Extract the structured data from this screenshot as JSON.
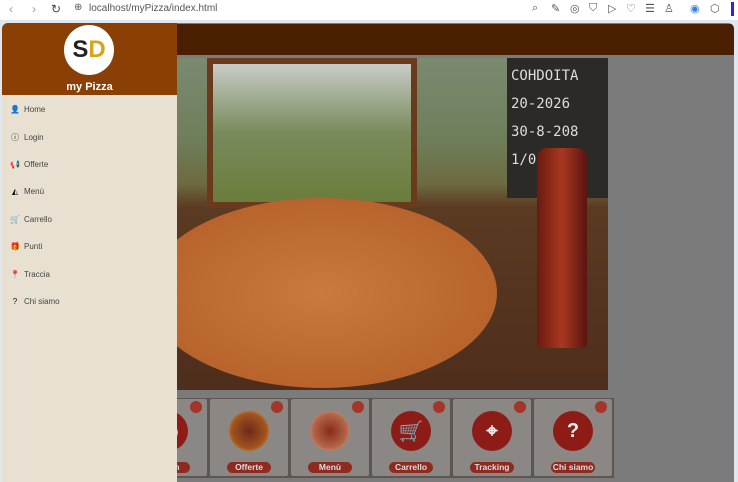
{
  "browser": {
    "url": "localhost/myPizza/index.html",
    "back_icon": "chevron-left",
    "forward_icon": "chevron-right",
    "reload_icon": "reload",
    "site_icon": "globe"
  },
  "sidebar": {
    "brand": "my Pizza",
    "logo_text": "SD",
    "items": [
      {
        "label": "Home",
        "icon": "user-icon",
        "glyph": "👤"
      },
      {
        "label": "Login",
        "icon": "info-circle-icon",
        "glyph": "ⓘ"
      },
      {
        "label": "Offerte",
        "icon": "megaphone-icon",
        "glyph": "📢"
      },
      {
        "label": "Menù",
        "icon": "pizza-slice-icon",
        "glyph": "◭"
      },
      {
        "label": "Carrello",
        "icon": "cart-icon",
        "glyph": "🛒"
      },
      {
        "label": "Punti",
        "icon": "gift-icon",
        "glyph": "🎁"
      },
      {
        "label": "Traccia",
        "icon": "map-pin-icon",
        "glyph": "📍"
      },
      {
        "label": "Chi siamo",
        "icon": "question-circle-icon",
        "glyph": "?"
      }
    ]
  },
  "hero": {
    "chalkboard": [
      "COHDOITA",
      "20-2026",
      "30-8-208",
      "1/0"
    ]
  },
  "tiles": [
    {
      "label": "Login",
      "glyph": "ⓘ"
    },
    {
      "label": "Offerte",
      "glyph": ""
    },
    {
      "label": "Menù",
      "glyph": ""
    },
    {
      "label": "Carrello",
      "glyph": "🛒"
    },
    {
      "label": "Tracking",
      "glyph": "⌖"
    },
    {
      "label": "Chi siamo",
      "glyph": "?"
    }
  ],
  "colors": {
    "sidebar_header": "#8a3f05",
    "topbar": "#4a1f00",
    "sidebar_bg": "#e8e1d1",
    "accent": "#8e1c16"
  }
}
